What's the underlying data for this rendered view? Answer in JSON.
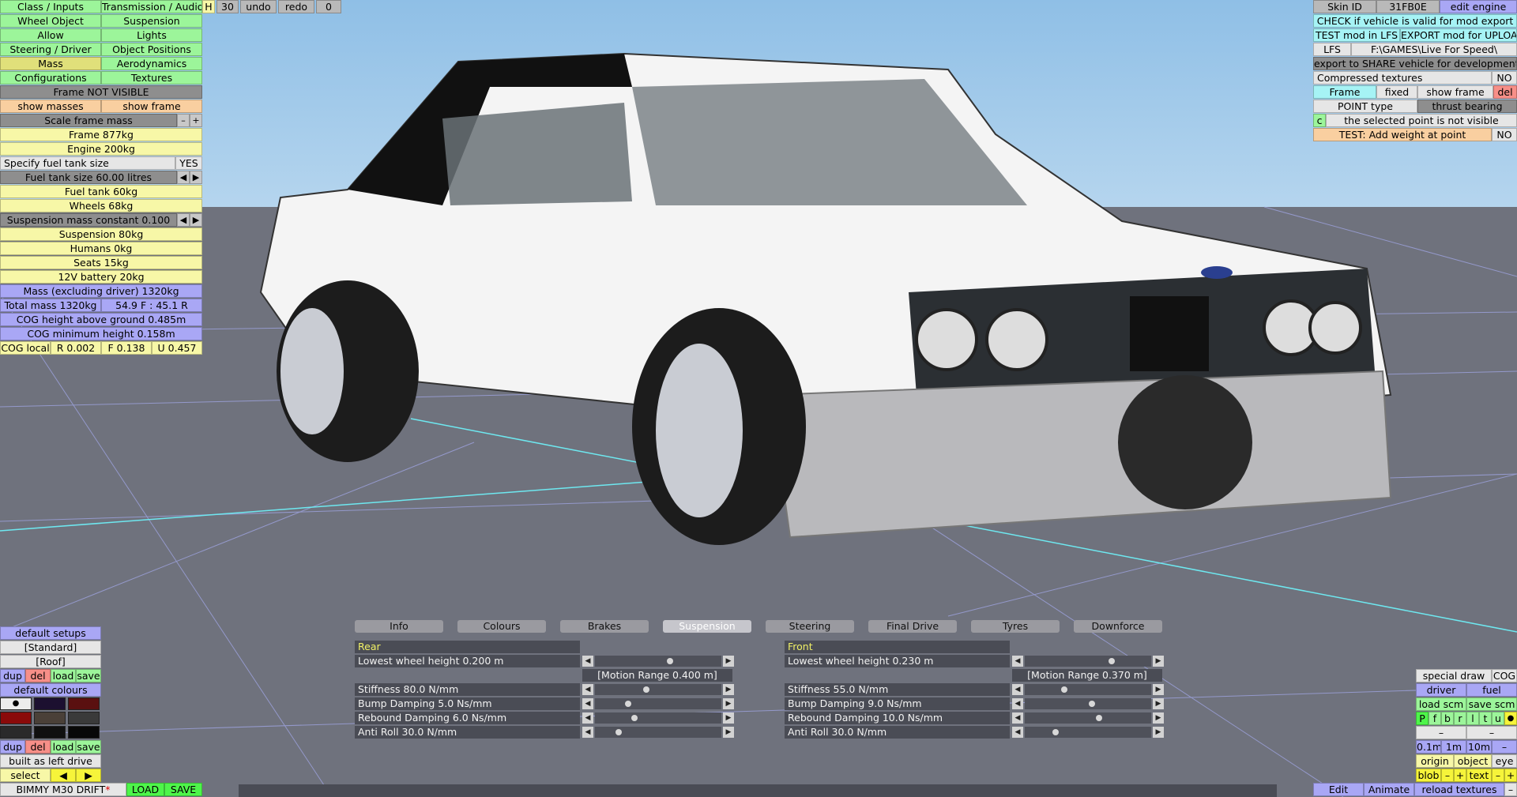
{
  "colors": {
    "green": "#9cf59a",
    "yellow": "#f7f7a7",
    "blue": "#a9a7f5",
    "orange": "#f9cfa0",
    "cyan": "#a6f3f5",
    "red": "#f78f88"
  },
  "left_menu": {
    "class_inputs": "Class / Inputs",
    "transmission_audio": "Transmission / Audio",
    "h": "H",
    "thirty": "30",
    "undo": "undo",
    "redo": "redo",
    "zero": "0",
    "wheel_object": "Wheel Object",
    "suspension": "Suspension",
    "allow": "Allow",
    "lights": "Lights",
    "steering_driver": "Steering / Driver",
    "object_positions": "Object Positions",
    "mass": "Mass",
    "aerodynamics": "Aerodynamics",
    "configurations": "Configurations",
    "textures": "Textures"
  },
  "mass_panel": {
    "frame_visible": "Frame NOT VISIBLE",
    "show_masses": "show masses",
    "show_frame": "show frame",
    "scale_frame_mass": "Scale frame mass",
    "minus": "–",
    "plus": "+",
    "frame": "Frame 877kg",
    "engine": "Engine 200kg",
    "specify_fuel": "Specify fuel tank size",
    "yes": "YES",
    "fuel_tank_size": "Fuel tank size 60.00 litres",
    "left": "◀",
    "right": "▶",
    "fuel_tank": "Fuel tank 60kg",
    "wheels": "Wheels 68kg",
    "susp_mass_const": "Suspension mass constant 0.100",
    "suspension": "Suspension 80kg",
    "humans": "Humans 0kg",
    "seats": "Seats 15kg",
    "battery": "12V battery 20kg",
    "mass_excl": "Mass (excluding driver) 1320kg",
    "total_mass": "Total mass 1320kg",
    "distribution": "54.9 F : 45.1 R",
    "cog_height": "COG height above ground 0.485m",
    "cog_min": "COG minimum height 0.158m",
    "cog_local": "COG local",
    "r": "R 0.002",
    "f": "F 0.138",
    "u": "U 0.457"
  },
  "top_right": {
    "skin_id": "Skin ID",
    "skin_code": "31FB0E",
    "edit_engine": "edit engine",
    "check_valid": "CHECK if vehicle is valid for mod export",
    "test_mod": "TEST mod in LFS",
    "export_mod": "EXPORT mod for UPLOAD",
    "lfs": "LFS",
    "path": "F:\\GAMES\\Live For Speed\\",
    "export_share": "export to SHARE vehicle for development",
    "compressed": "Compressed textures",
    "no": "NO",
    "frame": "Frame",
    "fixed": "fixed",
    "show_frame": "show frame",
    "del": "del",
    "point_type": "POINT type",
    "thrust_bearing": "thrust bearing",
    "c": "c",
    "not_visible": "the selected point is not visible",
    "test_weight": "TEST: Add weight at point",
    "no2": "NO"
  },
  "bottom_left": {
    "default_setups": "default setups",
    "standard": "[Standard]",
    "roof": "[Roof]",
    "dup": "dup",
    "del": "del",
    "load": "load",
    "save": "save",
    "default_colours": "default colours",
    "dot": "●",
    "dup2": "dup",
    "del2": "del",
    "load2": "load",
    "save2": "save",
    "built_as": "built as left drive",
    "select": "select",
    "prev": "◀",
    "next": "▶",
    "car_name": "BIMMY M30 DRIFT",
    "star": "*",
    "load_btn": "LOAD",
    "save_btn": "SAVE",
    "swatches": [
      "#ffffff",
      "#1c1030",
      "#5a1010",
      "#8a0a0a",
      "#4a4038",
      "#3a3a3a",
      "#2a2a2a",
      "#101010",
      "#080808"
    ]
  },
  "tabs": [
    "Info",
    "Colours",
    "Brakes",
    "Suspension",
    "Steering",
    "Final Drive",
    "Tyres",
    "Downforce"
  ],
  "active_tab": "Suspension",
  "suspension": {
    "rear": {
      "title": "Rear",
      "lowest": "Lowest wheel height 0.200 m",
      "motion": "[Motion Range 0.400 m]",
      "rows": [
        "Stiffness 80.0 N/mm",
        "Bump Damping 5.0 Ns/mm",
        "Rebound Damping 6.0 Ns/mm",
        "Anti Roll 30.0 N/mm"
      ],
      "knobs": [
        0.6,
        0.4,
        0.25,
        0.3,
        0.17
      ]
    },
    "front": {
      "title": "Front",
      "lowest": "Lowest wheel height 0.230 m",
      "motion": "[Motion Range 0.370 m]",
      "rows": [
        "Stiffness 55.0 N/mm",
        "Bump Damping 9.0 Ns/mm",
        "Rebound Damping 10.0 Ns/mm",
        "Anti Roll 30.0 N/mm"
      ],
      "knobs": [
        0.7,
        0.3,
        0.53,
        0.59,
        0.23
      ]
    }
  },
  "bottom_right": {
    "special_draw": "special draw",
    "cog": "COG",
    "driver": "driver",
    "fuel": "fuel",
    "load_scm": "load scm",
    "save_scm": "save scm",
    "letters": [
      "P",
      "f",
      "b",
      "r",
      "l",
      "t",
      "u"
    ],
    "dot": "●",
    "minus1": "–",
    "minus2": "–",
    "m01": "0.1m",
    "m1": "1m",
    "m10": "10m",
    "minus3": "–",
    "origin": "origin",
    "object": "object",
    "eye": "eye",
    "blob": "blob",
    "bminus": "–",
    "bplus": "+",
    "text": "text",
    "tminus": "–",
    "tplus": "+",
    "edit": "Edit",
    "animate": "Animate",
    "reload": "reload textures",
    "dash": "–"
  }
}
